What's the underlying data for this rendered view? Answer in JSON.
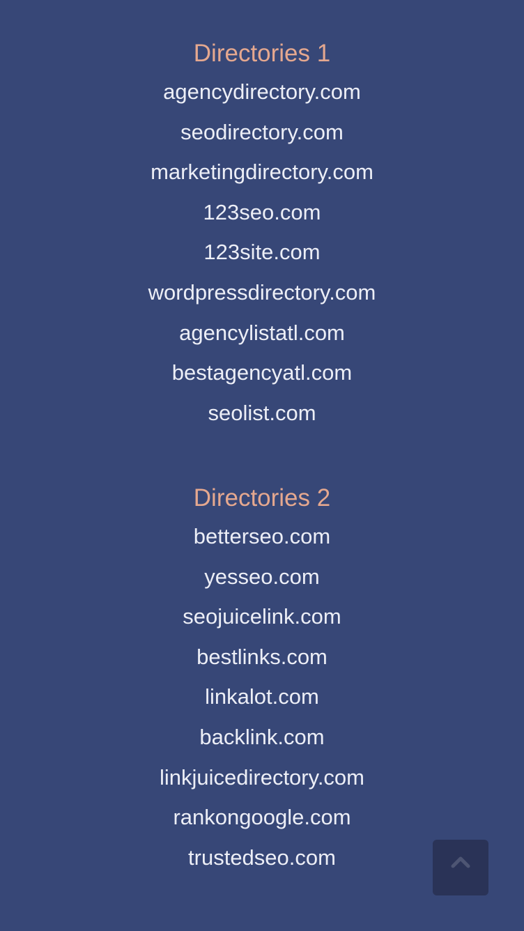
{
  "sections": [
    {
      "heading": "Directories 1",
      "links": [
        "agencydirectory.com",
        "seodirectory.com",
        "marketingdirectory.com",
        "123seo.com",
        "123site.com",
        "wordpressdirectory.com",
        "agencylistatl.com",
        "bestagencyatl.com",
        "seolist.com"
      ]
    },
    {
      "heading": "Directories 2",
      "links": [
        "betterseo.com",
        "yesseo.com",
        "seojuicelink.com",
        "bestlinks.com",
        "linkalot.com",
        "backlink.com",
        "linkjuicedirectory.com",
        "rankongoogle.com",
        "trustedseo.com"
      ]
    }
  ],
  "back_to_top": {
    "icon": "chevron-up-icon"
  },
  "colors": {
    "background": "#374777",
    "heading": "#e5a88f",
    "link": "#eceef6",
    "button_bg": "#2a3357",
    "button_icon": "#4d5573"
  }
}
